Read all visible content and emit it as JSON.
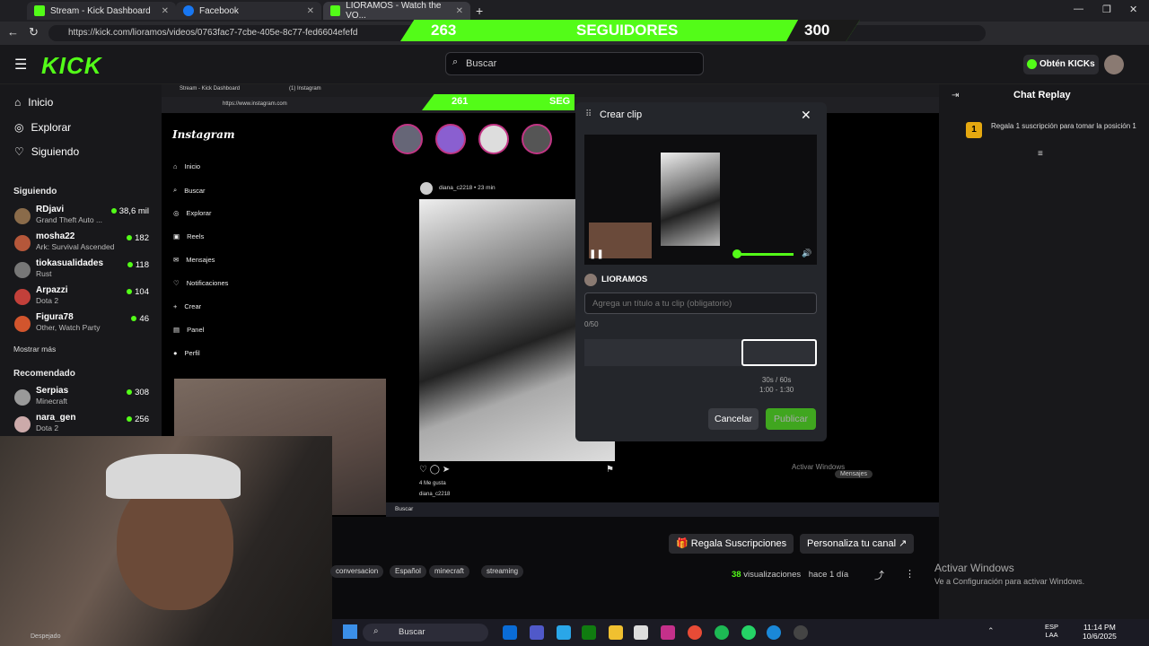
{
  "browser": {
    "tabs": [
      {
        "label": "Stream - Kick Dashboard",
        "color": "#53fc18"
      },
      {
        "label": "Facebook",
        "color": "#1877f2"
      },
      {
        "label": "LIORAMOS - Watch the VO...",
        "color": "#53fc18"
      }
    ],
    "url": "https://kick.com/lioramos/videos/0763fac7-7cbe-405e-8c77-fed6604efefd"
  },
  "followers_bar": {
    "left": "263",
    "label": "SEGUIDORES",
    "right": "300"
  },
  "header": {
    "logo": "KICK",
    "search_placeholder": "Buscar",
    "get_kicks": "Obtén KICKs"
  },
  "sidebar": {
    "nav": [
      "Inicio",
      "Explorar",
      "Siguiendo"
    ],
    "following_title": "Siguiendo",
    "following": [
      {
        "name": "RDjavi",
        "game": "Grand Theft Auto ...",
        "viewers": "38,6 mil",
        "color": "#8a6b4a"
      },
      {
        "name": "mosha22",
        "game": "Ark: Survival Ascended",
        "viewers": "182",
        "color": "#b5573a"
      },
      {
        "name": "tiokasualidades",
        "game": "Rust",
        "viewers": "118",
        "color": "#777"
      },
      {
        "name": "Arpazzi",
        "game": "Dota 2",
        "viewers": "104",
        "color": "#c2403a"
      },
      {
        "name": "Figura78",
        "game": "Other, Watch Party",
        "viewers": "46",
        "color": "#d2552d"
      }
    ],
    "show_more": "Mostrar más",
    "recommended_title": "Recomendado",
    "recommended": [
      {
        "name": "Serpias",
        "game": "Minecraft",
        "viewers": "308",
        "color": "#999"
      },
      {
        "name": "nara_gen",
        "game": "Dota 2",
        "viewers": "256",
        "color": "#caa"
      }
    ]
  },
  "inner_screen": {
    "tabs": [
      "Stream - Kick Dashboard",
      "(1) Instagram"
    ],
    "url": "https://www.instagram.com",
    "follow_left": "261",
    "follow_label": "SEG",
    "instagram_logo": "Instagram",
    "insta_nav": [
      "Inicio",
      "Buscar",
      "Explorar",
      "Reels",
      "Mensajes",
      "Notificaciones",
      "Crear",
      "Panel",
      "Perfil"
    ],
    "post_user": "diana_c2218 • 23 min",
    "likes": "4 Me gusta",
    "caption": "diana_c2218",
    "inner_search": "Buscar",
    "inner_activate": "Activar Windows",
    "messages": "Mensajes"
  },
  "clip_modal": {
    "title": "Crear clip",
    "author": "LIORAMOS",
    "title_placeholder": "Agrega un título a tu clip (obligatorio)",
    "counter": "0/50",
    "duration_line1": "30s / 60s",
    "duration_line2": "1:00 - 1:30",
    "cancel": "Cancelar",
    "publish": "Publicar"
  },
  "chat": {
    "title": "Chat Replay",
    "gift_badge": "1",
    "gift_text": "Regala 1 suscripción para tomar la posición 1"
  },
  "below": {
    "gift_subs": "Regala Suscripciones",
    "customize": "Personaliza tu canal",
    "tags": [
      "conversacion",
      "Español",
      "minecraft",
      "streaming"
    ],
    "views_count": "38",
    "views_label": "visualizaciones",
    "time_ago": "hace 1 día"
  },
  "windows": {
    "activate_title": "Activar Windows",
    "activate_sub": "Ve a Configuración para activar Windows.",
    "search": "Buscar",
    "lang": "ESP",
    "lang2": "LAA",
    "time": "11:14 PM",
    "date": "10/6/2025",
    "webcam_label": "Despejado"
  }
}
